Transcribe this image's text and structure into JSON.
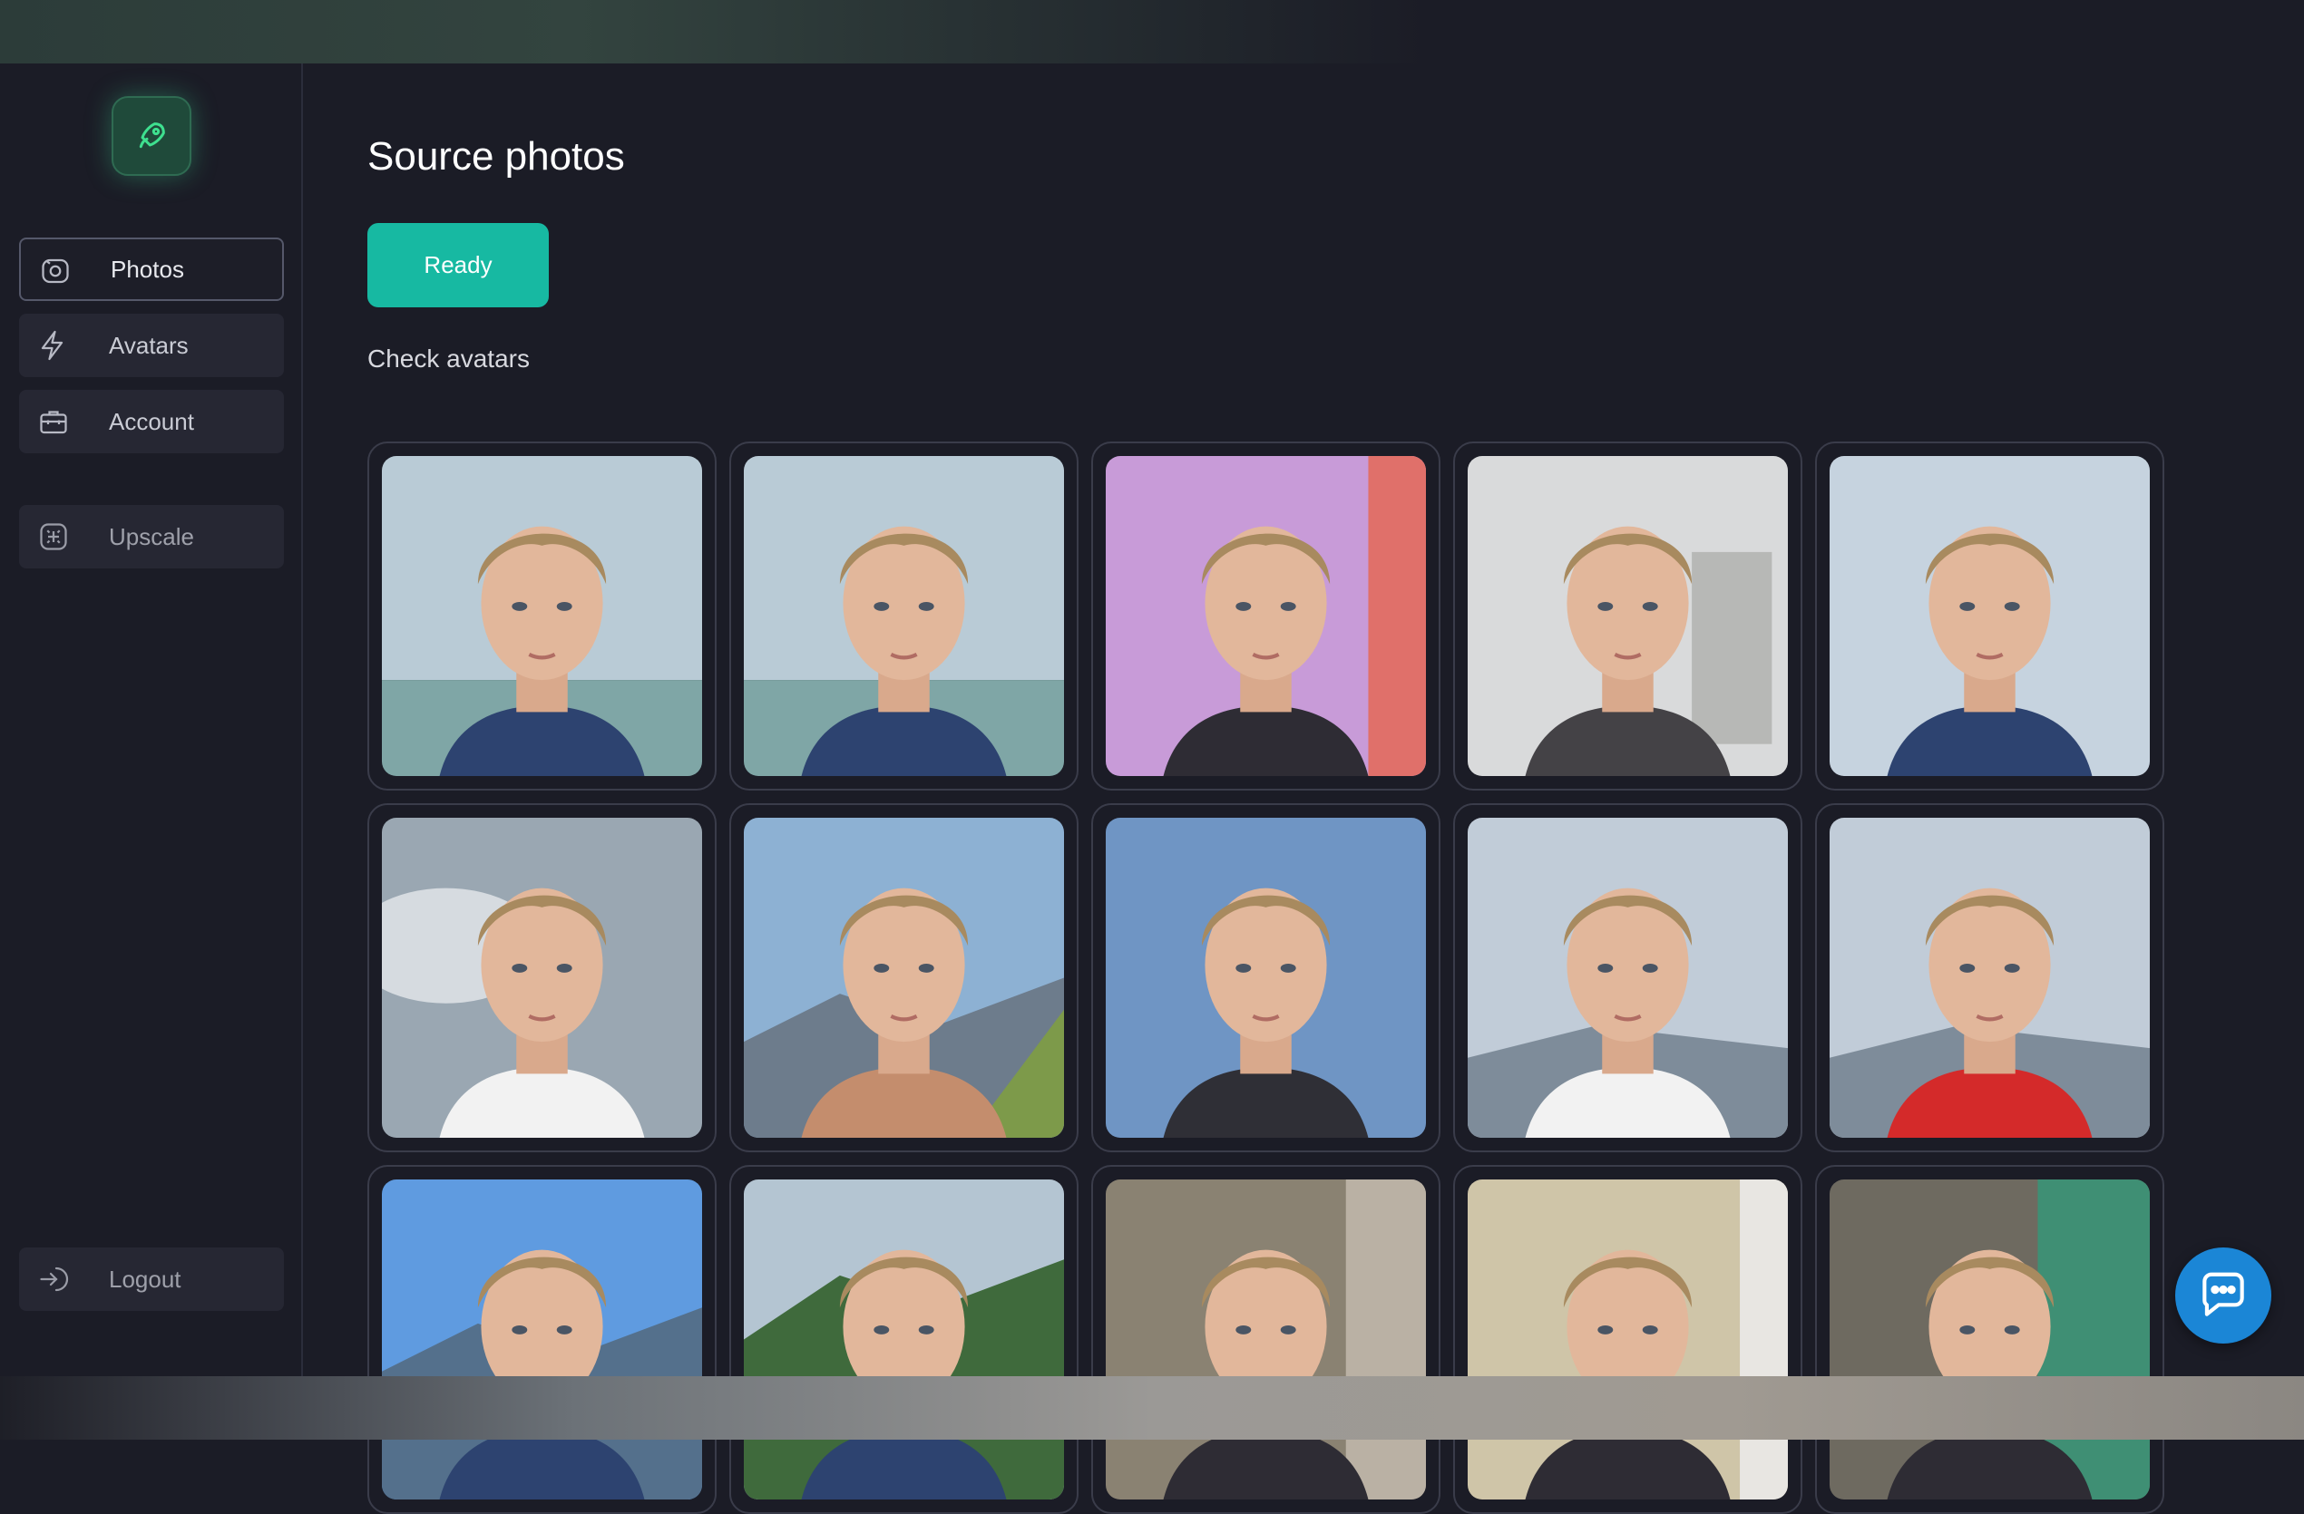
{
  "app": {
    "page_title": "Source photos",
    "ready_label": "Ready",
    "check_link": "Check avatars"
  },
  "sidebar": {
    "items": [
      {
        "label": "Photos",
        "icon": "camera-icon",
        "active": true
      },
      {
        "label": "Avatars",
        "icon": "lightning-icon",
        "active": false
      },
      {
        "label": "Account",
        "icon": "briefcase-icon",
        "active": false
      },
      {
        "label": "Upscale",
        "icon": "upscale-icon",
        "active": false
      }
    ],
    "logout_label": "Logout",
    "logout_icon": "logout-icon",
    "logo_icon": "rocket-icon"
  },
  "photos": [
    {
      "bg": "sea",
      "shirt": "#2d4370"
    },
    {
      "bg": "sea",
      "shirt": "#2d4370"
    },
    {
      "bg": "pink",
      "shirt": "#2e2c34"
    },
    {
      "bg": "lab",
      "shirt": "#444246"
    },
    {
      "bg": "sky",
      "shirt": "#2d4370"
    },
    {
      "bg": "clouds",
      "shirt": "#f2f2f2"
    },
    {
      "bg": "mountain",
      "shirt": "#c48d6d"
    },
    {
      "bg": "bluesky",
      "shirt": "#2f2f36"
    },
    {
      "bg": "haze",
      "shirt": "#f2f2f2"
    },
    {
      "bg": "haze",
      "shirt": "#d42a2a"
    },
    {
      "bg": "bluemtn",
      "shirt": "#2d4370"
    },
    {
      "bg": "forest",
      "shirt": "#2d4370"
    },
    {
      "bg": "stone",
      "shirt": "#2e2c34"
    },
    {
      "bg": "beige",
      "shirt": "#2e2c34"
    },
    {
      "bg": "wood",
      "shirt": "#2e2c34"
    }
  ],
  "colors": {
    "background": "#1b1c26",
    "accent": "#17b9a2",
    "chat": "#1b86d6"
  },
  "chat": {
    "icon": "chat-bubble-icon"
  }
}
